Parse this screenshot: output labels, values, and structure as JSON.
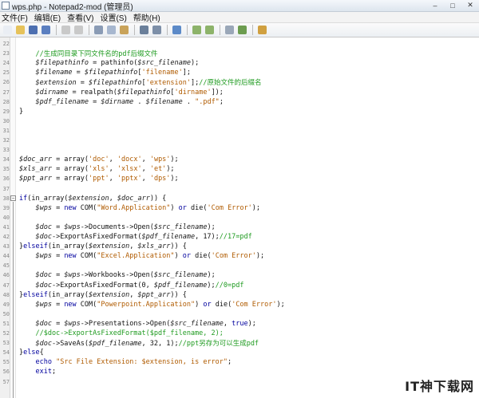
{
  "window": {
    "title": "wps.php - Notepad2-mod (管理员)"
  },
  "menu": [
    {
      "label": "文件(F)"
    },
    {
      "label": "编辑(E)"
    },
    {
      "label": "查看(V)"
    },
    {
      "label": "设置(S)"
    },
    {
      "label": "帮助(H)"
    }
  ],
  "toolbar": {
    "buttons": [
      {
        "name": "new-file-icon",
        "color": "#eaeef4"
      },
      {
        "name": "open-folder-icon",
        "color": "#e6c25a"
      },
      {
        "name": "save-icon",
        "color": "#4d6fb0"
      },
      {
        "name": "save-as-icon",
        "color": "#5b7fc0"
      },
      {
        "sep": true
      },
      {
        "name": "undo-icon",
        "color": "#c9c9c9"
      },
      {
        "name": "redo-icon",
        "color": "#c9c9c9"
      },
      {
        "sep": true
      },
      {
        "name": "cut-icon",
        "color": "#8a9bb5"
      },
      {
        "name": "copy-icon",
        "color": "#a7b7cf"
      },
      {
        "name": "paste-icon",
        "color": "#c9a35a"
      },
      {
        "sep": true
      },
      {
        "name": "find-icon",
        "color": "#6a7f9a"
      },
      {
        "name": "replace-icon",
        "color": "#7d8fa8"
      },
      {
        "sep": true
      },
      {
        "name": "word-wrap-icon",
        "color": "#5c8ac8"
      },
      {
        "sep": true
      },
      {
        "name": "zoom-in-icon",
        "color": "#8db36a"
      },
      {
        "name": "zoom-out-icon",
        "color": "#8db36a"
      },
      {
        "sep": true
      },
      {
        "name": "scheme-icon",
        "color": "#9aa7b8"
      },
      {
        "name": "settings-icon",
        "color": "#6c9c4f"
      },
      {
        "sep": true
      },
      {
        "name": "run-icon",
        "color": "#d0a040"
      }
    ]
  },
  "editor": {
    "lines": [
      {
        "n": "22",
        "y": 0,
        "code": []
      },
      {
        "n": "23",
        "y": 1,
        "code": [
          [
            "c",
            "    //生成同目录下同文件名的pdf后缀文件"
          ]
        ]
      },
      {
        "n": "24",
        "y": 2,
        "code": [
          [
            "v",
            "    $filepathinfo"
          ],
          [
            "t",
            " = pathinfo("
          ],
          [
            "v",
            "$src_filename"
          ],
          [
            "t",
            ");"
          ]
        ]
      },
      {
        "n": "25",
        "y": 3,
        "code": [
          [
            "v",
            "    $filename"
          ],
          [
            "t",
            " = "
          ],
          [
            "v",
            "$filepathinfo"
          ],
          [
            "t",
            "["
          ],
          [
            "s",
            "'filename'"
          ],
          [
            "t",
            "];"
          ]
        ]
      },
      {
        "n": "26",
        "y": 4,
        "code": [
          [
            "v",
            "    $extension"
          ],
          [
            "t",
            " = "
          ],
          [
            "v",
            "$filepathinfo"
          ],
          [
            "t",
            "["
          ],
          [
            "s",
            "'extension'"
          ],
          [
            "t",
            "];"
          ],
          [
            "c",
            "//原始文件的后缀名"
          ]
        ]
      },
      {
        "n": "27",
        "y": 5,
        "code": [
          [
            "v",
            "    $dirname"
          ],
          [
            "t",
            " = realpath("
          ],
          [
            "v",
            "$filepathinfo"
          ],
          [
            "t",
            "["
          ],
          [
            "s",
            "'dirname'"
          ],
          [
            "t",
            "]);"
          ]
        ]
      },
      {
        "n": "28",
        "y": 6,
        "code": [
          [
            "v",
            "    $pdf_filename"
          ],
          [
            "t",
            " = "
          ],
          [
            "v",
            "$dirname"
          ],
          [
            "t",
            " . "
          ],
          [
            "v",
            "$filename"
          ],
          [
            "t",
            " . "
          ],
          [
            "s",
            "\".pdf\""
          ],
          [
            "t",
            ";"
          ]
        ]
      },
      {
        "n": "29",
        "y": 7,
        "code": [
          [
            "t",
            "}"
          ]
        ]
      },
      {
        "n": "30",
        "y": 8,
        "code": []
      },
      {
        "n": "31",
        "y": 9,
        "code": []
      },
      {
        "n": "32",
        "y": 10,
        "code": []
      },
      {
        "n": "33",
        "y": 11,
        "code": []
      },
      {
        "n": "34",
        "y": 12,
        "code": [
          [
            "v",
            "$doc_arr"
          ],
          [
            "t",
            " = array("
          ],
          [
            "s",
            "'doc'"
          ],
          [
            "t",
            ", "
          ],
          [
            "s",
            "'docx'"
          ],
          [
            "t",
            ", "
          ],
          [
            "s",
            "'wps'"
          ],
          [
            "t",
            ");"
          ]
        ]
      },
      {
        "n": "35",
        "y": 13,
        "code": [
          [
            "v",
            "$xls_arr"
          ],
          [
            "t",
            " = array("
          ],
          [
            "s",
            "'xls'"
          ],
          [
            "t",
            ", "
          ],
          [
            "s",
            "'xlsx'"
          ],
          [
            "t",
            ", "
          ],
          [
            "s",
            "'et'"
          ],
          [
            "t",
            ");"
          ]
        ]
      },
      {
        "n": "36",
        "y": 14,
        "code": [
          [
            "v",
            "$ppt_arr"
          ],
          [
            "t",
            " = array("
          ],
          [
            "s",
            "'ppt'"
          ],
          [
            "t",
            ", "
          ],
          [
            "s",
            "'pptx'"
          ],
          [
            "t",
            ", "
          ],
          [
            "s",
            "'dps'"
          ],
          [
            "t",
            ");"
          ]
        ]
      },
      {
        "n": "37",
        "y": 15,
        "code": []
      },
      {
        "n": "38",
        "y": 16,
        "code": [
          [
            "k",
            "if"
          ],
          [
            "t",
            "(in_array("
          ],
          [
            "v",
            "$extension"
          ],
          [
            "t",
            ", "
          ],
          [
            "v",
            "$doc_arr"
          ],
          [
            "t",
            ")) {"
          ]
        ]
      },
      {
        "n": "39",
        "y": 17,
        "code": [
          [
            "v",
            "    $wps"
          ],
          [
            "t",
            " = "
          ],
          [
            "k",
            "new"
          ],
          [
            "t",
            " COM("
          ],
          [
            "s",
            "\"Word.Application\""
          ],
          [
            "t",
            ") "
          ],
          [
            "k",
            "or"
          ],
          [
            "t",
            " die("
          ],
          [
            "s",
            "'Com Error'"
          ],
          [
            "t",
            ");"
          ]
        ]
      },
      {
        "n": "40",
        "y": 18,
        "code": []
      },
      {
        "n": "41",
        "y": 19,
        "code": [
          [
            "v",
            "    $doc"
          ],
          [
            "t",
            " = "
          ],
          [
            "v",
            "$wps"
          ],
          [
            "t",
            "->Documents->Open("
          ],
          [
            "v",
            "$src_filename"
          ],
          [
            "t",
            ");"
          ]
        ]
      },
      {
        "n": "42",
        "y": 20,
        "code": [
          [
            "v",
            "    $doc"
          ],
          [
            "t",
            "->ExportAsFixedFormat("
          ],
          [
            "v",
            "$pdf_filename"
          ],
          [
            "t",
            ", 17);"
          ],
          [
            "c",
            "//17=pdf"
          ]
        ]
      },
      {
        "n": "43",
        "y": 21,
        "code": [
          [
            "t",
            "}"
          ],
          [
            "k",
            "elseif"
          ],
          [
            "t",
            "(in_array("
          ],
          [
            "v",
            "$extension"
          ],
          [
            "t",
            ", "
          ],
          [
            "v",
            "$xls_arr"
          ],
          [
            "t",
            ")) {"
          ]
        ]
      },
      {
        "n": "44",
        "y": 22,
        "code": [
          [
            "v",
            "    $wps"
          ],
          [
            "t",
            " = "
          ],
          [
            "k",
            "new"
          ],
          [
            "t",
            " COM("
          ],
          [
            "s",
            "\"Excel.Application\""
          ],
          [
            "t",
            ") "
          ],
          [
            "k",
            "or"
          ],
          [
            "t",
            " die("
          ],
          [
            "s",
            "'Com Error'"
          ],
          [
            "t",
            ");"
          ]
        ]
      },
      {
        "n": "45",
        "y": 23,
        "code": []
      },
      {
        "n": "46",
        "y": 24,
        "code": [
          [
            "v",
            "    $doc"
          ],
          [
            "t",
            " = "
          ],
          [
            "v",
            "$wps"
          ],
          [
            "t",
            "->Workbooks->Open("
          ],
          [
            "v",
            "$src_filename"
          ],
          [
            "t",
            ");"
          ]
        ]
      },
      {
        "n": "47",
        "y": 25,
        "code": [
          [
            "v",
            "    $doc"
          ],
          [
            "t",
            "->ExportAsFixedFormat(0, "
          ],
          [
            "v",
            "$pdf_filename"
          ],
          [
            "t",
            ");"
          ],
          [
            "c",
            "//0=pdf"
          ]
        ]
      },
      {
        "n": "48",
        "y": 26,
        "code": [
          [
            "t",
            "}"
          ],
          [
            "k",
            "elseif"
          ],
          [
            "t",
            "(in_array("
          ],
          [
            "v",
            "$extension"
          ],
          [
            "t",
            ", "
          ],
          [
            "v",
            "$ppt_arr"
          ],
          [
            "t",
            ")) {"
          ]
        ]
      },
      {
        "n": "49",
        "y": 27,
        "code": [
          [
            "v",
            "    $wps"
          ],
          [
            "t",
            " = "
          ],
          [
            "k",
            "new"
          ],
          [
            "t",
            " COM("
          ],
          [
            "s",
            "\"Powerpoint.Application\""
          ],
          [
            "t",
            ") "
          ],
          [
            "k",
            "or"
          ],
          [
            "t",
            " die("
          ],
          [
            "s",
            "'Com Error'"
          ],
          [
            "t",
            ");"
          ]
        ]
      },
      {
        "n": "50",
        "y": 28,
        "code": []
      },
      {
        "n": "51",
        "y": 29,
        "code": [
          [
            "v",
            "    $doc"
          ],
          [
            "t",
            " = "
          ],
          [
            "v",
            "$wps"
          ],
          [
            "t",
            "->Presentations->Open("
          ],
          [
            "v",
            "$src_filename"
          ],
          [
            "t",
            ", "
          ],
          [
            "k",
            "true"
          ],
          [
            "t",
            ");"
          ]
        ]
      },
      {
        "n": "52",
        "y": 30,
        "code": [
          [
            "c",
            "    //$doc->ExportAsFixedFormat($pdf_filename, 2);"
          ]
        ]
      },
      {
        "n": "53",
        "y": 31,
        "code": [
          [
            "v",
            "    $doc"
          ],
          [
            "t",
            "->SaveAs("
          ],
          [
            "v",
            "$pdf_filename"
          ],
          [
            "t",
            ", 32, 1);"
          ],
          [
            "c",
            "//ppt另存为可以生成pdf"
          ]
        ]
      },
      {
        "n": "54",
        "y": 32,
        "code": [
          [
            "t",
            "}"
          ],
          [
            "k",
            "else"
          ],
          [
            "t",
            "{"
          ]
        ]
      },
      {
        "n": "55",
        "y": 33,
        "code": [
          [
            "t",
            "    "
          ],
          [
            "k",
            "echo"
          ],
          [
            "t",
            " "
          ],
          [
            "s",
            "\"Src File Extension: $extension, is error\""
          ],
          [
            "t",
            ";"
          ]
        ]
      },
      {
        "n": "56",
        "y": 34,
        "code": [
          [
            "t",
            "    "
          ],
          [
            "k",
            "exit"
          ],
          [
            "t",
            ";"
          ]
        ]
      },
      {
        "n": "57",
        "y": 35,
        "code": []
      }
    ]
  },
  "watermark": "IT神下载网"
}
